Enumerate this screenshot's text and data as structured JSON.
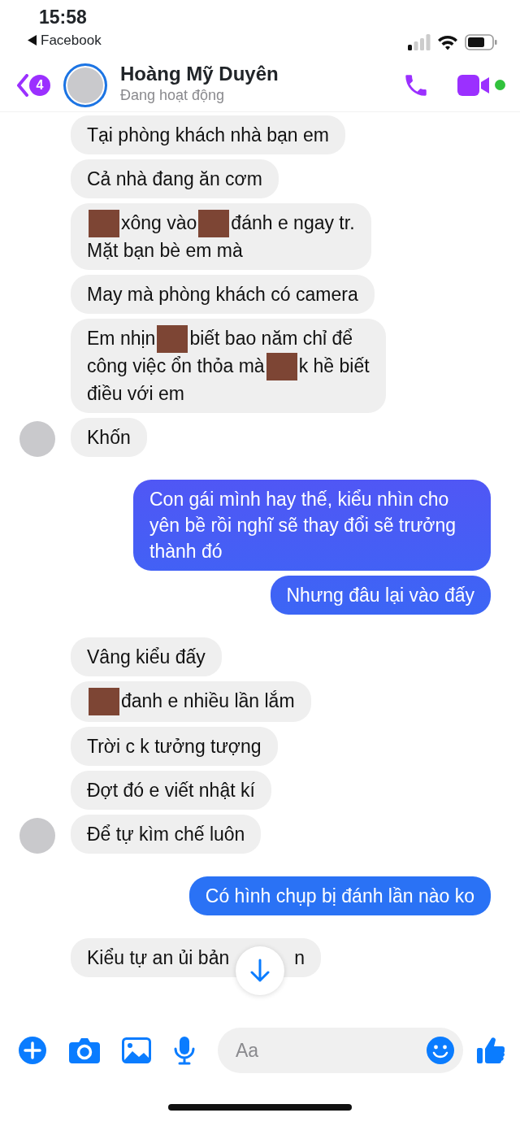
{
  "status_bar": {
    "time": "15:58",
    "back_app": "Facebook"
  },
  "header": {
    "unread_count": "4",
    "contact_name": "Hoàng Mỹ Duyên",
    "presence": "Đang hoạt động",
    "online": true
  },
  "messages": [
    {
      "outgoing": false,
      "avatar": false,
      "parts": [
        {
          "kind": "text",
          "text": "Tại phòng khách nhà bạn em"
        }
      ]
    },
    {
      "outgoing": false,
      "avatar": false,
      "parts": [
        {
          "kind": "text",
          "text": "Cả nhà đang ăn cơm"
        }
      ]
    },
    {
      "outgoing": false,
      "avatar": false,
      "parts": [
        {
          "kind": "redacted"
        },
        {
          "kind": "text",
          "text": "xông vào"
        },
        {
          "kind": "redacted"
        },
        {
          "kind": "text",
          "text": "đánh e ngay tr."
        },
        {
          "kind": "break"
        },
        {
          "kind": "text",
          "text": "Mặt bạn bè em mà"
        }
      ]
    },
    {
      "outgoing": false,
      "avatar": false,
      "parts": [
        {
          "kind": "text",
          "text": "May mà phòng khách có camera"
        }
      ]
    },
    {
      "outgoing": false,
      "avatar": false,
      "parts": [
        {
          "kind": "text",
          "text": "Em nhịn"
        },
        {
          "kind": "redacted"
        },
        {
          "kind": "text",
          "text": "biết bao năm chỉ để"
        },
        {
          "kind": "break"
        },
        {
          "kind": "text",
          "text": "công việc ổn thỏa mà"
        },
        {
          "kind": "redacted"
        },
        {
          "kind": "text",
          "text": "k hề biết"
        },
        {
          "kind": "break"
        },
        {
          "kind": "text",
          "text": "điều với em"
        }
      ]
    },
    {
      "outgoing": false,
      "avatar": true,
      "parts": [
        {
          "kind": "text",
          "text": "Khốn"
        }
      ]
    },
    {
      "outgoing": true,
      "parts": [
        {
          "kind": "text",
          "text": "Con gái mình hay thế, kiểu nhìn cho yên bề rồi nghĩ sẽ thay đổi sẽ trưởng thành đó"
        }
      ]
    },
    {
      "outgoing": true,
      "parts": [
        {
          "kind": "text",
          "text": "Nhưng đâu lại vào đấy"
        }
      ]
    },
    {
      "outgoing": false,
      "avatar": false,
      "parts": [
        {
          "kind": "text",
          "text": "Vâng kiểu đấy"
        }
      ]
    },
    {
      "outgoing": false,
      "avatar": false,
      "parts": [
        {
          "kind": "redacted"
        },
        {
          "kind": "text",
          "text": "đanh e nhiều lần lắm"
        }
      ]
    },
    {
      "outgoing": false,
      "avatar": false,
      "parts": [
        {
          "kind": "text",
          "text": "Trời c k tưởng tượng"
        }
      ]
    },
    {
      "outgoing": false,
      "avatar": false,
      "parts": [
        {
          "kind": "text",
          "text": "Đợt đó e viết nhật kí"
        }
      ]
    },
    {
      "outgoing": false,
      "avatar": true,
      "parts": [
        {
          "kind": "text",
          "text": "Để tự kìm chế luôn"
        }
      ]
    },
    {
      "outgoing": true,
      "parts": [
        {
          "kind": "text",
          "text": "Có hình chụp bị đánh lần nào ko"
        }
      ]
    },
    {
      "outgoing": false,
      "avatar": false,
      "parts": [
        {
          "kind": "text",
          "text": "Kiểu tự an ủi bản"
        },
        {
          "kind": "covered"
        },
        {
          "kind": "text",
          "text": "n"
        }
      ]
    }
  ],
  "composer": {
    "placeholder": "Aa"
  }
}
